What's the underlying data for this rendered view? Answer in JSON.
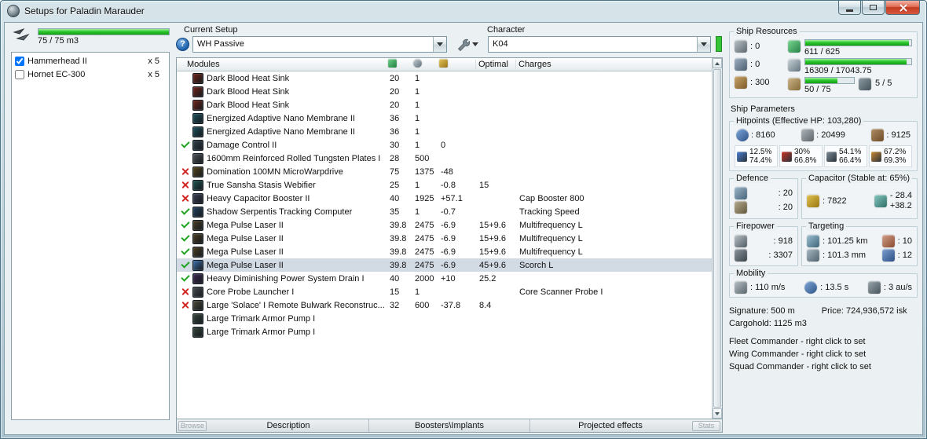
{
  "window": {
    "title": "Setups for Paladin Marauder"
  },
  "colors": {
    "bar_green": "#2ec82e",
    "check_green": "#1fa51f",
    "cross_red": "#cf2626",
    "selected_row": "#d2dae4",
    "online_green": "#35c435",
    "titlebar_top": "#d7e5eb",
    "titlebar_bottom": "#a9c2cd"
  },
  "icons": {
    "help": "?"
  },
  "drones": {
    "capacity_text": "75 / 75 m3",
    "capacity_pct": 100,
    "items": [
      {
        "checked": true,
        "name": "Hammerhead II",
        "qty": "x 5"
      },
      {
        "checked": false,
        "name": "Hornet EC-300",
        "qty": "x 5"
      }
    ]
  },
  "setup": {
    "label": "Current Setup",
    "value": "WH Passive"
  },
  "character": {
    "label": "Character",
    "value": "K04"
  },
  "modules_table": {
    "header": {
      "name": "Modules",
      "optimal": "Optimal",
      "charges": "Charges"
    },
    "rows": [
      {
        "status": "",
        "selected": false,
        "ic": "#6e2418",
        "name": "Dark Blood Heat Sink",
        "cpu": "20",
        "pg": "1",
        "cap": "",
        "optimal": "",
        "charges": ""
      },
      {
        "status": "",
        "selected": false,
        "ic": "#6e2418",
        "name": "Dark Blood Heat Sink",
        "cpu": "20",
        "pg": "1",
        "cap": "",
        "optimal": "",
        "charges": ""
      },
      {
        "status": "",
        "selected": false,
        "ic": "#6e2418",
        "name": "Dark Blood Heat Sink",
        "cpu": "20",
        "pg": "1",
        "cap": "",
        "optimal": "",
        "charges": ""
      },
      {
        "status": "",
        "selected": false,
        "ic": "#1d4f5a",
        "name": "Energized Adaptive Nano Membrane II",
        "cpu": "36",
        "pg": "1",
        "cap": "",
        "optimal": "",
        "charges": ""
      },
      {
        "status": "",
        "selected": false,
        "ic": "#1d4f5a",
        "name": "Energized Adaptive Nano Membrane II",
        "cpu": "36",
        "pg": "1",
        "cap": "",
        "optimal": "",
        "charges": ""
      },
      {
        "status": "check",
        "selected": false,
        "ic": "#31404a",
        "name": "Damage Control II",
        "cpu": "30",
        "pg": "1",
        "cap": "0",
        "optimal": "",
        "charges": ""
      },
      {
        "status": "",
        "selected": false,
        "ic": "#4e5358",
        "name": "1600mm Reinforced Rolled Tungsten Plates I",
        "cpu": "28",
        "pg": "500",
        "cap": "",
        "optimal": "",
        "charges": ""
      },
      {
        "status": "cross",
        "selected": false,
        "ic": "#54431d",
        "name": "Domination 100MN MicroWarpdrive",
        "cpu": "75",
        "pg": "1375",
        "cap": "-48",
        "optimal": "",
        "charges": ""
      },
      {
        "status": "cross",
        "selected": false,
        "ic": "#1d5450",
        "name": "True Sansha Stasis Webifier",
        "cpu": "25",
        "pg": "1",
        "cap": "-0.8",
        "optimal": "15",
        "charges": ""
      },
      {
        "status": "cross",
        "selected": false,
        "ic": "#3a3f54",
        "name": "Heavy Capacitor Booster II",
        "cpu": "40",
        "pg": "1925",
        "cap": "+57.1",
        "optimal": "",
        "charges": "Cap Booster 800"
      },
      {
        "status": "check",
        "selected": false,
        "ic": "#24415e",
        "name": "Shadow Serpentis Tracking Computer",
        "cpu": "35",
        "pg": "1",
        "cap": "-0.7",
        "optimal": "",
        "charges": "Tracking Speed"
      },
      {
        "status": "check",
        "selected": false,
        "ic": "#4a3c22",
        "name": "Mega Pulse Laser II",
        "cpu": "39.8",
        "pg": "2475",
        "cap": "-6.9",
        "optimal": "15+9.6",
        "charges": "Multifrequency L"
      },
      {
        "status": "check",
        "selected": false,
        "ic": "#4a3c22",
        "name": "Mega Pulse Laser II",
        "cpu": "39.8",
        "pg": "2475",
        "cap": "-6.9",
        "optimal": "15+9.6",
        "charges": "Multifrequency L"
      },
      {
        "status": "check",
        "selected": false,
        "ic": "#4a3c22",
        "name": "Mega Pulse Laser II",
        "cpu": "39.8",
        "pg": "2475",
        "cap": "-6.9",
        "optimal": "15+9.6",
        "charges": "Multifrequency L"
      },
      {
        "status": "check",
        "selected": true,
        "ic": "#3c6ea8",
        "name": "Mega Pulse Laser II",
        "cpu": "39.8",
        "pg": "2475",
        "cap": "-6.9",
        "optimal": "45+9.6",
        "charges": "Scorch L"
      },
      {
        "status": "check",
        "selected": false,
        "ic": "#3d2a52",
        "name": "Heavy Diminishing Power System Drain I",
        "cpu": "40",
        "pg": "2000",
        "cap": "+10",
        "optimal": "25.2",
        "charges": ""
      },
      {
        "status": "cross",
        "selected": false,
        "ic": "#474c50",
        "name": "Core Probe Launcher I",
        "cpu": "15",
        "pg": "1",
        "cap": "",
        "optimal": "",
        "charges": "Core Scanner Probe I"
      },
      {
        "status": "cross",
        "selected": false,
        "ic": "#4c4a38",
        "name": "Large 'Solace' I Remote Bulwark Reconstruc...",
        "cpu": "32",
        "pg": "600",
        "cap": "-37.8",
        "optimal": "8.4",
        "charges": ""
      },
      {
        "status": "",
        "selected": false,
        "ic": "#35463b",
        "name": "Large Trimark Armor Pump I",
        "cpu": "",
        "pg": "",
        "cap": "",
        "optimal": "",
        "charges": ""
      },
      {
        "status": "",
        "selected": false,
        "ic": "#35463b",
        "name": "Large Trimark Armor Pump I",
        "cpu": "",
        "pg": "",
        "cap": "",
        "optimal": "",
        "charges": ""
      }
    ]
  },
  "bottom_bar": {
    "left_button": "Browse",
    "right_button": "Stats",
    "tabs": [
      "Description",
      "Boosters\\Implants",
      "Projected effects"
    ]
  },
  "resources": {
    "title": "Ship Resources",
    "turrets": ": 0",
    "launchers": ": 0",
    "calibration": ": 300",
    "cpu": {
      "text": "611 / 625",
      "pct": 97.8
    },
    "powergrid": {
      "text": "16309 / 17043.75",
      "pct": 95.7
    },
    "upgrades": {
      "text": "50 / 75",
      "pct": 66.7
    },
    "drones": "5 / 5"
  },
  "parameters": {
    "title": "Ship Parameters",
    "hitpoints": {
      "title": "Hitpoints (Effective HP: 103,280)",
      "shield": ": 8160",
      "armor": ": 20499",
      "structure": ": 9125",
      "resists": [
        {
          "type": "em",
          "color": "#4a7fd4",
          "top": "12.5%",
          "bottom": "74.4%"
        },
        {
          "type": "thermal",
          "color": "#cc3322",
          "top": "30%",
          "bottom": "66.8%"
        },
        {
          "type": "kinetic",
          "color": "#7d8b96",
          "top": "54.1%",
          "bottom": "66.4%"
        },
        {
          "type": "explosive",
          "color": "#cc8833",
          "top": "67.2%",
          "bottom": "69.3%"
        }
      ]
    },
    "defence": {
      "title": "Defence",
      "v1": ": 20",
      "v2": ": 20"
    },
    "capacitor": {
      "title": "Capacitor (Stable at: 65%)",
      "amount": ": 7822",
      "delta_minus": "- 28.4",
      "delta_plus": "+38.2"
    },
    "firepower": {
      "title": "Firepower",
      "volley": ": 918",
      "dps": ": 3307"
    },
    "targeting": {
      "title": "Targeting",
      "range": ": 101.25 km",
      "max_targets": ": 10",
      "scan_res": ": 101.3 mm",
      "sensor": ": 12"
    },
    "mobility": {
      "title": "Mobility",
      "speed": ": 110 m/s",
      "align": ": 13.5 s",
      "warp": ": 3 au/s"
    },
    "signature": "Signature: 500 m",
    "price": "Price: 724,936,572 isk",
    "cargohold": "Cargohold: 1125 m3",
    "fleet": "Fleet Commander - right click to set",
    "wing": "Wing Commander - right click to set",
    "squad": "Squad Commander - right click to set"
  }
}
